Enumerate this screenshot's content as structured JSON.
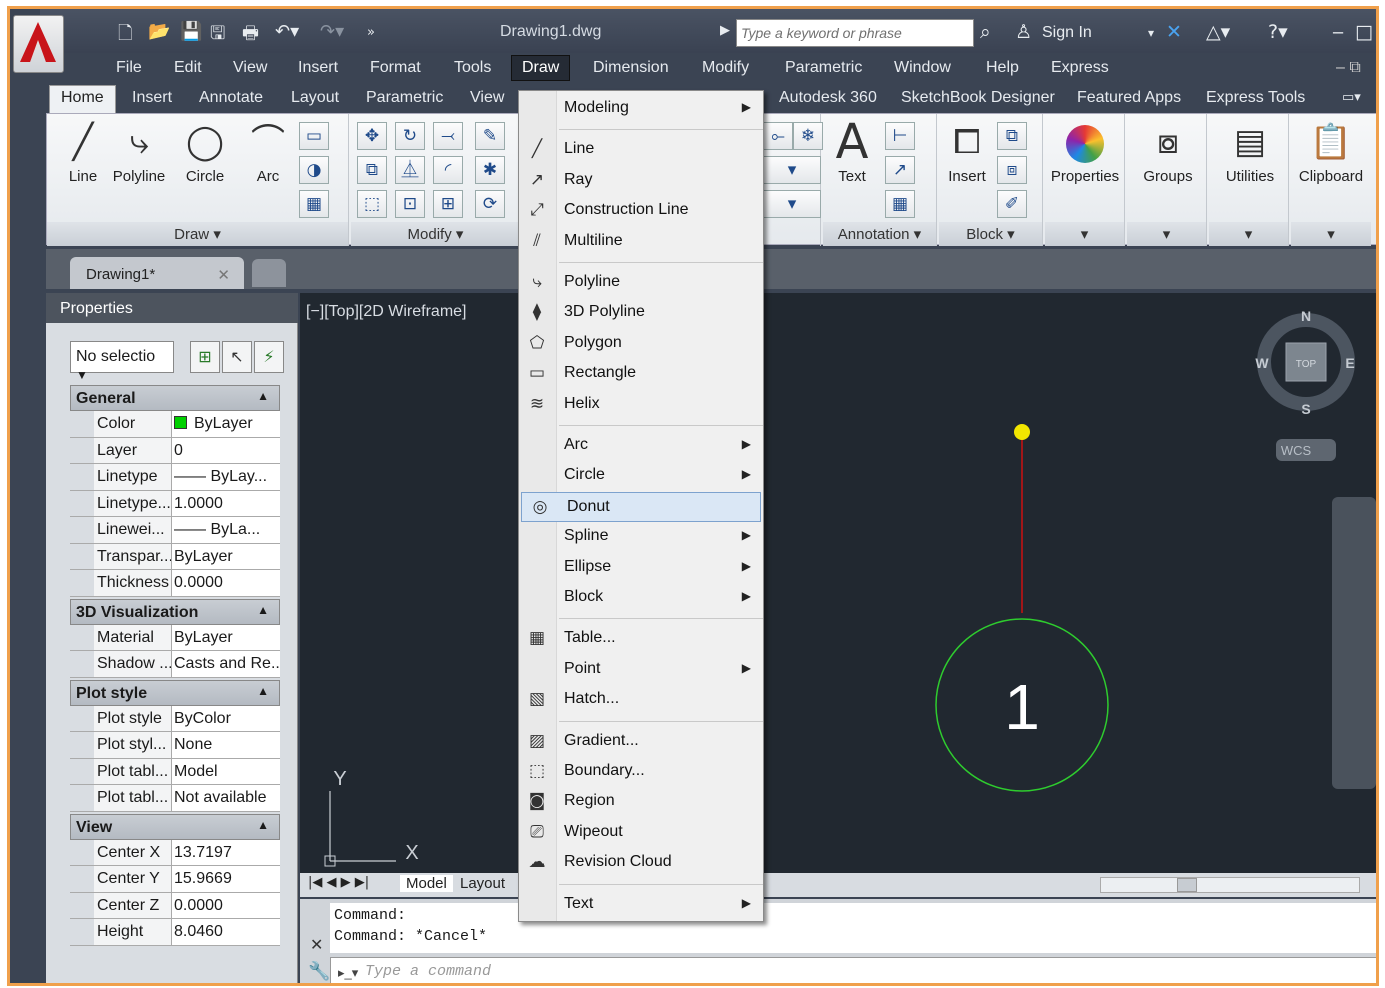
{
  "title": {
    "document": "Drawing1.dwg",
    "search_placeholder": "Type a keyword or phrase",
    "sign_in": "Sign In"
  },
  "menubar": [
    "File",
    "Edit",
    "View",
    "Insert",
    "Format",
    "Tools",
    "Draw",
    "Dimension",
    "Modify",
    "Parametric",
    "Window",
    "Help",
    "Express"
  ],
  "ribbon_tabs": [
    "Home",
    "Insert",
    "Annotate",
    "Layout",
    "Parametric",
    "View",
    "Autodesk 360",
    "SketchBook Designer",
    "Featured Apps",
    "Express Tools"
  ],
  "ribbon": {
    "draw": {
      "line": "Line",
      "polyline": "Polyline",
      "circle": "Circle",
      "arc": "Arc",
      "footer": "Draw"
    },
    "modify_footer": "Modify",
    "annotation": {
      "text": "Text",
      "footer": "Annotation"
    },
    "block": {
      "insert": "Insert",
      "footer": "Block"
    },
    "properties": "Properties",
    "groups": "Groups",
    "utilities": "Utilities",
    "clipboard": "Clipboard"
  },
  "doc_tab": "Drawing1*",
  "properties_panel": {
    "title": "Properties",
    "selection": "No selectio",
    "sections": [
      {
        "name": "General",
        "rows": [
          [
            "Color",
            "ByLayer"
          ],
          [
            "Layer",
            "0"
          ],
          [
            "Linetype",
            "—— ByLay..."
          ],
          [
            "Linetype...",
            "1.0000"
          ],
          [
            "Linewei...",
            "—— ByLa..."
          ],
          [
            "Transpar...",
            "ByLayer"
          ],
          [
            "Thickness",
            "0.0000"
          ]
        ]
      },
      {
        "name": "3D Visualization",
        "rows": [
          [
            "Material",
            "ByLayer"
          ],
          [
            "Shadow ...",
            "Casts and Re..."
          ]
        ]
      },
      {
        "name": "Plot style",
        "rows": [
          [
            "Plot style",
            "ByColor"
          ],
          [
            "Plot styl...",
            "None"
          ],
          [
            "Plot tabl...",
            "Model"
          ],
          [
            "Plot tabl...",
            "Not available"
          ]
        ]
      },
      {
        "name": "View",
        "rows": [
          [
            "Center X",
            "13.7197"
          ],
          [
            "Center Y",
            "15.9669"
          ],
          [
            "Center Z",
            "0.0000"
          ],
          [
            "Height",
            "8.0460"
          ]
        ]
      }
    ]
  },
  "viewport": {
    "label": "[−][Top][2D Wireframe]",
    "circle_label": "1",
    "compass": {
      "n": "N",
      "s": "S",
      "e": "E",
      "w": "W",
      "top": "TOP"
    },
    "wcs": "WCS",
    "ucs_x": "X",
    "ucs_y": "Y"
  },
  "model_tabs": [
    "Model",
    "Layout"
  ],
  "command": {
    "line1": "Command:",
    "line2": "Command: *Cancel*",
    "placeholder": "Type a command"
  },
  "draw_menu": [
    {
      "label": "Modeling",
      "icon": "",
      "sub": true
    },
    {
      "sep": true
    },
    {
      "label": "Line",
      "icon": "line-icon",
      "sub": false
    },
    {
      "label": "Ray",
      "icon": "ray-icon",
      "sub": false
    },
    {
      "label": "Construction Line",
      "icon": "xline-icon",
      "sub": false
    },
    {
      "label": "Multiline",
      "icon": "multiline-icon",
      "sub": false
    },
    {
      "sep": true
    },
    {
      "label": "Polyline",
      "icon": "polyline-icon",
      "sub": false
    },
    {
      "label": "3D Polyline",
      "icon": "3d-polyline-icon",
      "sub": false
    },
    {
      "label": "Polygon",
      "icon": "polygon-icon",
      "sub": false
    },
    {
      "label": "Rectangle",
      "icon": "rectangle-icon",
      "sub": false
    },
    {
      "label": "Helix",
      "icon": "helix-icon",
      "sub": false
    },
    {
      "sep": true
    },
    {
      "label": "Arc",
      "icon": "",
      "sub": true
    },
    {
      "label": "Circle",
      "icon": "",
      "sub": true
    },
    {
      "label": "Donut",
      "icon": "donut-icon",
      "sub": false,
      "highlight": true
    },
    {
      "label": "Spline",
      "icon": "",
      "sub": true
    },
    {
      "label": "Ellipse",
      "icon": "",
      "sub": true
    },
    {
      "label": "Block",
      "icon": "",
      "sub": true
    },
    {
      "sep": true
    },
    {
      "label": "Table...",
      "icon": "table-icon",
      "sub": false
    },
    {
      "label": "Point",
      "icon": "",
      "sub": true
    },
    {
      "label": "Hatch...",
      "icon": "hatch-icon",
      "sub": false
    },
    {
      "sep": true
    },
    {
      "label": "Gradient...",
      "icon": "gradient-icon",
      "sub": false
    },
    {
      "label": "Boundary...",
      "icon": "boundary-icon",
      "sub": false
    },
    {
      "label": "Region",
      "icon": "region-icon",
      "sub": false
    },
    {
      "label": "Wipeout",
      "icon": "wipeout-icon",
      "sub": false
    },
    {
      "label": "Revision Cloud",
      "icon": "revision-cloud-icon",
      "sub": false
    },
    {
      "sep": true
    },
    {
      "label": "Text",
      "icon": "",
      "sub": true
    }
  ],
  "colors": {
    "accent": "#f0a04b",
    "circle": "#2ecc2e",
    "line": "#cc1111",
    "point": "#f2e600",
    "autocad_red": "#c8141a"
  }
}
